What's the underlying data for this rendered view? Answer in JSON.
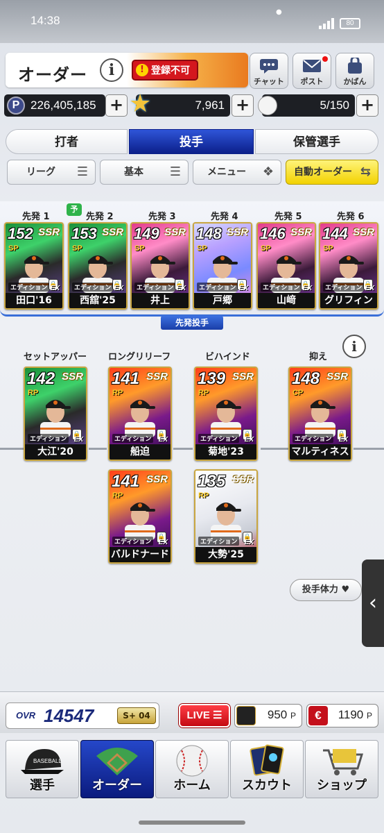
{
  "status": {
    "time": "14:38",
    "battery": "80"
  },
  "header": {
    "title": "オーダー",
    "info": "i",
    "register_badge": "登録不可",
    "buttons": [
      {
        "label": "チャット",
        "icon": "chat-icon"
      },
      {
        "label": "ポスト",
        "icon": "mail-icon"
      },
      {
        "label": "かばん",
        "icon": "bag-icon"
      }
    ]
  },
  "currency": {
    "points": "226,405,185",
    "stars": "7,961",
    "balls": "5/150",
    "plus": "+"
  },
  "tabs": [
    "打者",
    "投手",
    "保管選手"
  ],
  "active_tab": 1,
  "filters": [
    {
      "label": "リーグ",
      "icon": "☰"
    },
    {
      "label": "基本",
      "icon": "☰"
    },
    {
      "label": "メニュー",
      "icon": "❖"
    },
    {
      "label": "自動オーダー",
      "icon": "⇆"
    }
  ],
  "starters": {
    "section_label": "先発投手",
    "slots": [
      {
        "slot": "先発 1",
        "ovr": "152",
        "pos": "SP",
        "rarity": "SSR",
        "name": "田口'16",
        "theme": "green"
      },
      {
        "slot": "先発 2",
        "ovr": "153",
        "pos": "SP",
        "rarity": "SSR",
        "name": "西舘'25",
        "theme": "green"
      },
      {
        "slot": "先発 3",
        "ovr": "149",
        "pos": "SP",
        "rarity": "SSR",
        "name": "井上",
        "theme": "pink"
      },
      {
        "slot": "先発 4",
        "ovr": "148",
        "pos": "SP",
        "rarity": "SSR",
        "name": "戸郷",
        "theme": "crystal"
      },
      {
        "slot": "先発 5",
        "ovr": "146",
        "pos": "SP",
        "rarity": "SSR",
        "name": "山﨑",
        "theme": "pink"
      },
      {
        "slot": "先発 6",
        "ovr": "144",
        "pos": "SP",
        "rarity": "SSR",
        "name": "グリフィン",
        "theme": "pink"
      }
    ],
    "badge": "予"
  },
  "relievers": {
    "positions": [
      "セットアッパー",
      "ロングリリーフ",
      "ビハインド",
      "抑え"
    ],
    "cards": [
      {
        "ovr": "142",
        "pos": "RP",
        "rarity": "SSR",
        "name": "大江'20",
        "theme": "green"
      },
      {
        "ovr": "141",
        "pos": "RP",
        "rarity": "SSR",
        "name": "船迫",
        "theme": "fire"
      },
      {
        "ovr": "139",
        "pos": "RP",
        "rarity": "SSR",
        "name": "菊地'23",
        "theme": "fire"
      },
      {
        "ovr": "148",
        "pos": "CP",
        "rarity": "SSR",
        "name": "マルティネス",
        "theme": "fire"
      },
      {
        "ovr": "141",
        "pos": "RP",
        "rarity": "SSR",
        "name": "バルドナード",
        "theme": "fire"
      },
      {
        "ovr": "135",
        "pos": "RP",
        "rarity": "SSR",
        "name": "大勢'25",
        "theme": "white"
      }
    ],
    "edition": "エディション",
    "ex": "EX"
  },
  "stamina_button": "投手体力",
  "bottom": {
    "ovr_label": "OVR",
    "ovr_value": "14547",
    "rank": "S+ 04",
    "live": "LIVE",
    "coin1": "950",
    "coin2": "1190",
    "unit": "P"
  },
  "nav": [
    {
      "label": "選手",
      "icon": "cap-icon"
    },
    {
      "label": "オーダー",
      "icon": "field-icon"
    },
    {
      "label": "ホーム",
      "icon": "baseball-icon"
    },
    {
      "label": "スカウト",
      "icon": "cards-icon"
    },
    {
      "label": "ショップ",
      "icon": "cart-icon"
    }
  ],
  "active_nav": 1,
  "colors": {
    "accent_blue": "#0b1f8a",
    "badge_red": "#d4171e",
    "live_red": "#c40a12",
    "gold": "#c9a640"
  }
}
